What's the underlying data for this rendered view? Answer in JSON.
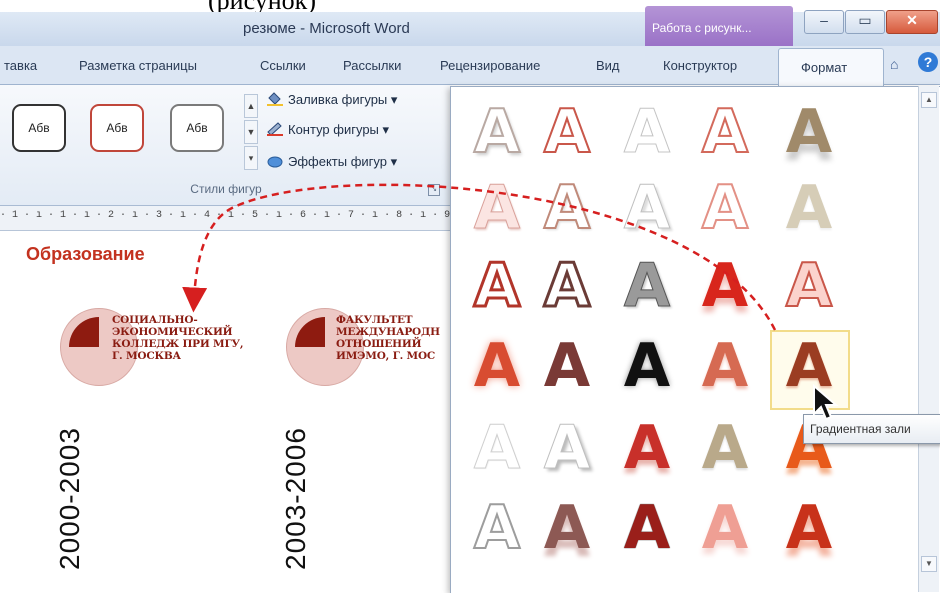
{
  "caption_top": "(рисунок)",
  "window": {
    "title": "резюме - Microsoft Word",
    "context_tab_header": "Работа с рисунк...",
    "buttons": {
      "minimize": "–",
      "maximize": "▭",
      "close": "✕"
    }
  },
  "tabs": [
    "тавка",
    "Разметка страницы",
    "Ссылки",
    "Рассылки",
    "Рецензирование",
    "Вид",
    "Конструктор",
    "Формат"
  ],
  "active_tab": "Формат",
  "ribbon": {
    "style_samples": [
      "Абв",
      "Абв",
      "Абв"
    ],
    "commands": {
      "fill": "Заливка фигуры ▾",
      "outline": "Контур фигуры ▾",
      "effects": "Эффекты фигур ▾"
    },
    "group_label": "Стили фигур"
  },
  "ruler": "· 1 · ı · 1 · ı · 2 · ı · 3 · ı · 4 · ı · 5 · ı · 6 · ı · 7 · ı · 8 · ı · 9 · ı",
  "document": {
    "heading": "Образование",
    "entries": [
      {
        "years": "2000-2003",
        "text": [
          "СОЦИАЛЬНО-",
          "ЭКОНОМИЧЕСКИЙ",
          "КОЛЛЕДЖ ПРИ МГУ,",
          "Г. МОСКВА"
        ]
      },
      {
        "years": "2003-2006",
        "text": [
          "ФАКУЛЬТЕТ",
          "МЕЖДУНАРОДН",
          "ОТНОШЕНИЙ",
          "ИМЭМО, Г. МОС"
        ]
      }
    ]
  },
  "wordart_letter": "A",
  "tooltip": "Градиентная зали",
  "colors": {
    "accent_red": "#c3321f",
    "dark_red": "#8e1b10",
    "context_purple": "#9a72c7",
    "tooltip_bg": "#f4f6f9"
  }
}
